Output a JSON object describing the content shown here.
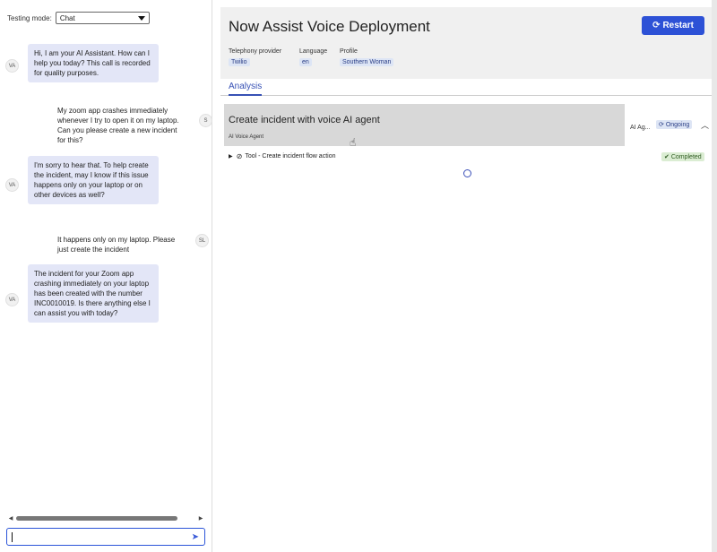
{
  "chat": {
    "mode_label": "Testing mode:",
    "mode_value": "Chat",
    "messages": [
      {
        "sender": "VA",
        "text": "Hi, I am your AI Assistant. How can I help you today? This call is recorded for quality purposes."
      },
      {
        "sender": "S",
        "text": "My zoom app crashes immediately whenever I try to open it on my laptop. Can you please create a new incident for this?"
      },
      {
        "sender": "VA",
        "text": "I'm sorry to hear that. To help create the incident, may I know if this issue happens only on your laptop or on other devices as well?"
      },
      {
        "sender": "SL",
        "text": "It happens only on my laptop. Please just create the incident"
      },
      {
        "sender": "VA",
        "text": "The incident for your Zoom app crashing immediately on your laptop has been created with the number INC0010019. Is there anything else I can assist you with today?"
      }
    ],
    "input_value": ""
  },
  "header": {
    "title": "Now Assist Voice Deployment",
    "restart_label": "Restart",
    "telephony_label": "Telephony provider",
    "telephony_value": "Twilio",
    "language_label": "Language",
    "language_value": "en",
    "profile_label": "Profile",
    "profile_value": "Southern Woman"
  },
  "tabs": {
    "analysis": "Analysis"
  },
  "incident": {
    "title": "Create incident with voice AI agent",
    "subtitle": "AI Voice Agent",
    "agent_label": "AI Ag...",
    "status": "Ongoing",
    "tool_label": "Tool - Create incident flow action",
    "tool_status": "Completed"
  },
  "colors": {
    "accent": "#2d51d6",
    "bubble": "#e3e6f7",
    "completed_bg": "#dbedd3"
  }
}
